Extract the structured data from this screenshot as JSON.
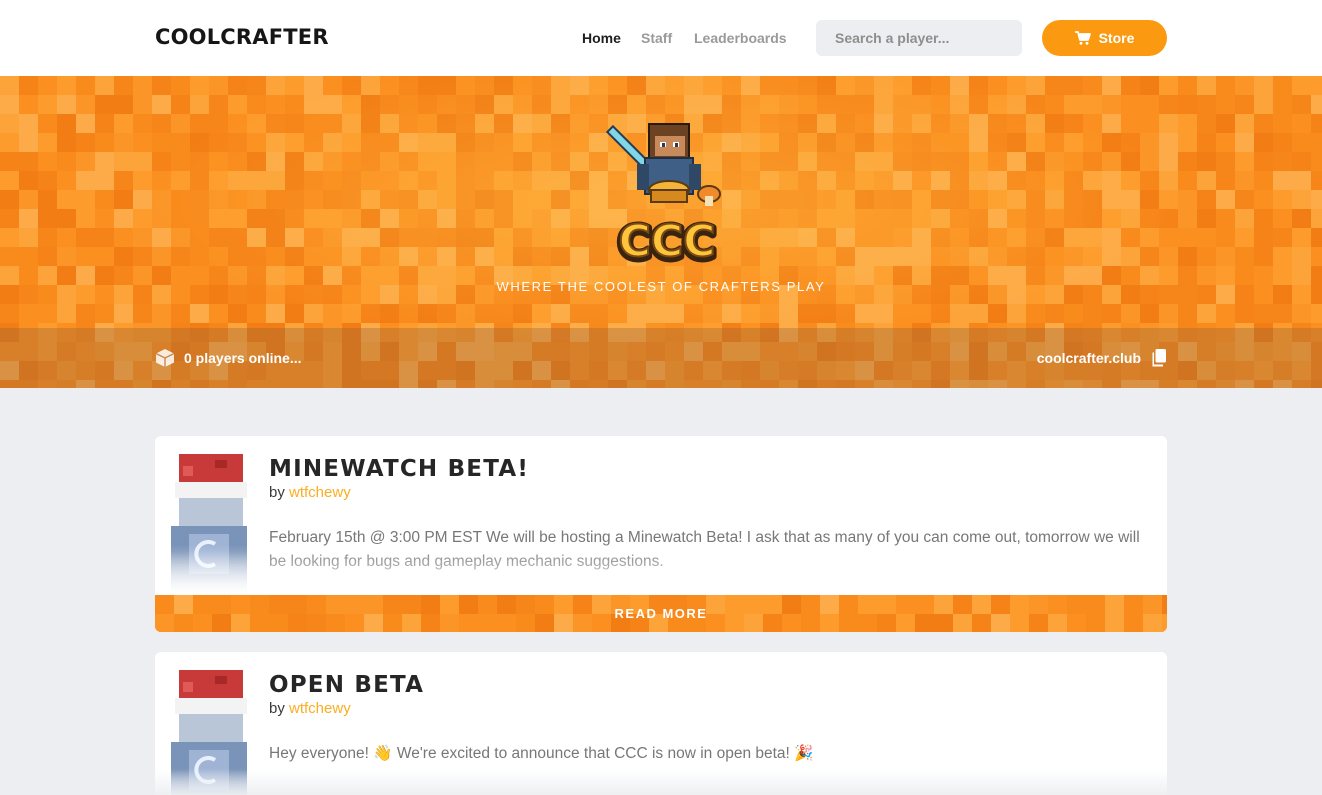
{
  "brand": "COOLCRAFTER",
  "nav": {
    "links": [
      {
        "label": "Home",
        "active": true
      },
      {
        "label": "Staff",
        "active": false
      },
      {
        "label": "Leaderboards",
        "active": false
      }
    ],
    "search_placeholder": "Search a player...",
    "store_label": "Store",
    "store_icon": "cart-icon"
  },
  "hero": {
    "logo_text": "CCC",
    "tagline": "WHERE THE COOLEST OF CRAFTERS PLAY",
    "players_online": "0 players online...",
    "server_ip": "coolcrafter.club",
    "online_icon": "cube-icon",
    "copy_icon": "copy-icon"
  },
  "posts": [
    {
      "title": "MINEWATCH BETA!",
      "by": "by",
      "author": "wtfchewy",
      "excerpt": "February 15th @ 3:00 PM EST We will be hosting a Minewatch Beta! I ask that as many of you can come out, tomorrow we will be looking for bugs and gameplay mechanic suggestions.",
      "read_more": "READ MORE"
    },
    {
      "title": "OPEN BETA",
      "by": "by",
      "author": "wtfchewy",
      "excerpt": "Hey everyone! 👋 We're excited to announce that CCC is now in open beta! 🎉"
    }
  ],
  "colors": {
    "accent": "#fb9a10",
    "hero_orange": "#fb9020",
    "author": "#fbae22",
    "background": "#eceef1"
  }
}
